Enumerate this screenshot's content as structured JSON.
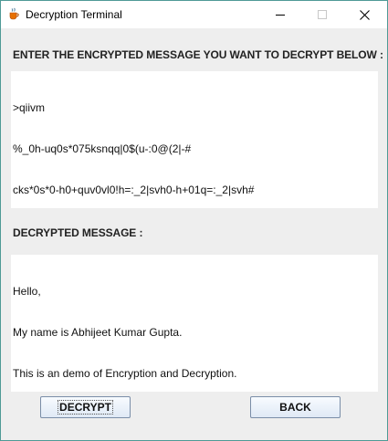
{
  "window": {
    "title": "Decryption Terminal",
    "icon": "java-cup-icon",
    "controls": [
      "minimize",
      "maximize",
      "close"
    ]
  },
  "encrypted_section": {
    "label": "ENTER THE ENCRYPTED MESSAGE YOU WANT TO DECRYPT BELOW :",
    "lines": [
      ">qiivm",
      "%_0h-uq0s*075ksnqq|0$(u-:0@(2|-#",
      "cks*0s*0-h0+quv0vl0!h=:_2|svh0-h+01q=:_2|svh#"
    ]
  },
  "decrypted_section": {
    "label": "DECRYPTED MESSAGE :",
    "lines": [
      "Hello,",
      "My name is Abhijeet Kumar Gupta.",
      "This is an demo of Encryption and Decryption."
    ]
  },
  "buttons": {
    "decrypt": "DECRYPT",
    "back": "BACK"
  }
}
